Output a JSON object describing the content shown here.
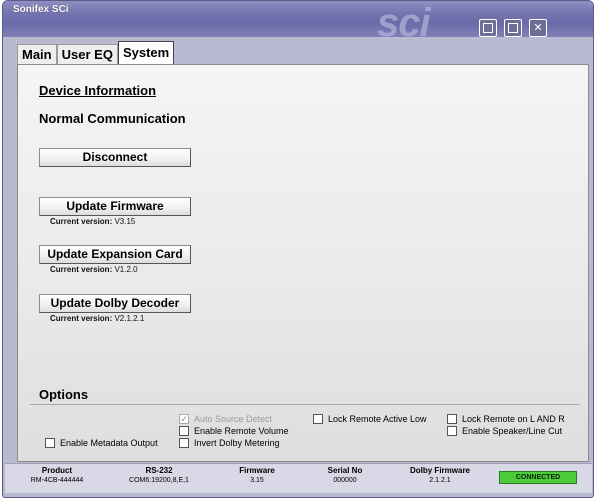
{
  "window": {
    "title": "Sonifex SCi",
    "logo_text": "sci",
    "minimize_label": "_",
    "maximize_label": "□",
    "close_label": "✕"
  },
  "tabs": [
    {
      "label": "Main"
    },
    {
      "label": "User EQ"
    },
    {
      "label": "System"
    }
  ],
  "active_tab": "System",
  "system": {
    "device_heading": "Device Information",
    "status_text": "Normal Communication",
    "disconnect_label": "Disconnect",
    "update_firmware_label": "Update Firmware",
    "firmware_version_label": "Current version:",
    "firmware_version": "V3.15",
    "update_expansion_label": "Update Expansion Card",
    "expansion_version_label": "Current version:",
    "expansion_version": "V1.2.0",
    "update_dolby_label": "Update Dolby Decoder",
    "dolby_version_label": "Current version:",
    "dolby_version": "V2.1.2.1"
  },
  "options": {
    "heading": "Options",
    "auto_source_detect": {
      "label": "Auto Source Detect",
      "checked": true,
      "disabled": true
    },
    "enable_remote_volume": {
      "label": "Enable Remote Volume",
      "checked": false
    },
    "invert_dolby_metering": {
      "label": "Invert Dolby Metering",
      "checked": false
    },
    "lock_remote_active_low": {
      "label": "Lock Remote Active Low",
      "checked": false
    },
    "lock_remote_l_and_r": {
      "label": "Lock Remote on L AND R",
      "checked": false
    },
    "enable_speaker_line_cut": {
      "label": "Enable Speaker/Line Cut",
      "checked": false
    },
    "enable_metadata_output": {
      "label": "Enable Metadata Output",
      "checked": false
    }
  },
  "status_bar": {
    "product_label": "Product",
    "product_value": "RM-4CB-444444",
    "rs232_label": "RS-232",
    "rs232_value": "COM6:19200,8,E,1",
    "firmware_label": "Firmware",
    "firmware_value": "3.15",
    "serial_label": "Serial No",
    "serial_value": "000000",
    "dolby_label": "Dolby Firmware",
    "dolby_value": "2.1.2.1",
    "connection_status": "CONNECTED"
  },
  "colors": {
    "titlebar": "#7474b0",
    "connected": "#4dcc3a"
  }
}
